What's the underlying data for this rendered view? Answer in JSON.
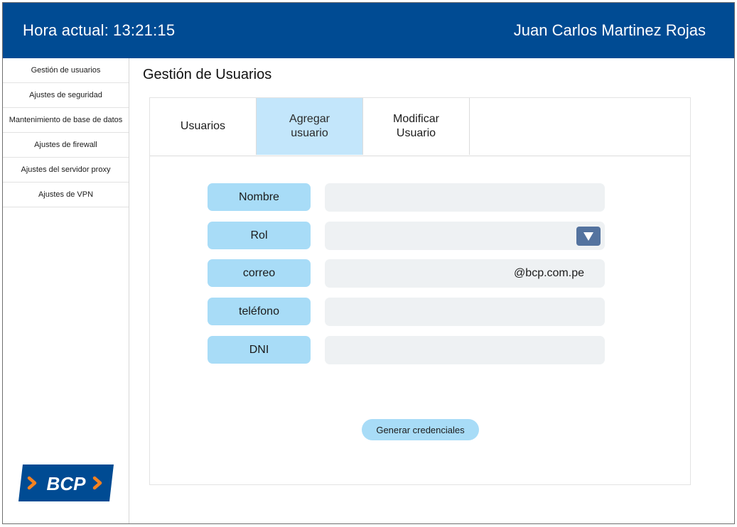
{
  "header": {
    "clock_label": "Hora actual:",
    "clock_time": "13:21:15",
    "user_name": "Juan Carlos Martinez Rojas"
  },
  "sidebar": {
    "items": [
      {
        "label": "Gestión de usuarios"
      },
      {
        "label": "Ajustes de seguridad"
      },
      {
        "label": "Mantenimiento de base de datos"
      },
      {
        "label": "Ajustes de firewall"
      },
      {
        "label": "Ajustes del servidor proxy"
      },
      {
        "label": "Ajustes de VPN"
      }
    ],
    "logo_text": "BCP"
  },
  "main": {
    "title": "Gestión de Usuarios",
    "tabs": [
      {
        "label": "Usuarios",
        "active": false
      },
      {
        "label": "Agregar usuario",
        "active": true
      },
      {
        "label": "Modificar Usuario",
        "active": false
      }
    ],
    "form": {
      "nombre_label": "Nombre",
      "nombre_value": "",
      "rol_label": "Rol",
      "rol_value": "",
      "correo_label": "correo",
      "correo_value": "",
      "correo_suffix": "@bcp.com.pe",
      "telefono_label": "teléfono",
      "telefono_value": "",
      "dni_label": "DNI",
      "dni_value": ""
    },
    "generate_button": "Generar credenciales"
  },
  "colors": {
    "header_bg": "#004b93",
    "active_tab": "#c3e6fb",
    "label_pill": "#a8dcf7",
    "field_bg": "#eef1f3",
    "dropdown_btn": "#54739f",
    "logo_orange": "#f58220"
  },
  "icons": {
    "dropdown": "chevron-down-icon"
  }
}
